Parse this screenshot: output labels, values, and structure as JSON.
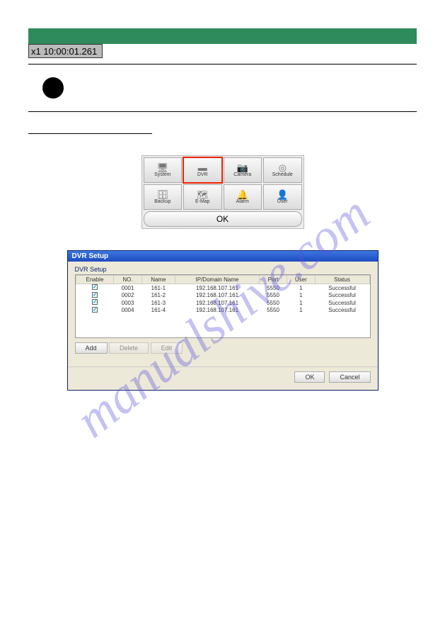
{
  "timestamp": "x1 10:00:01.261",
  "setup_grid": {
    "buttons": [
      {
        "label": "System",
        "icon": "🖥"
      },
      {
        "label": "DVR",
        "icon": "▬"
      },
      {
        "label": "Camera",
        "icon": "📷"
      },
      {
        "label": "Schedule",
        "icon": "◎"
      },
      {
        "label": "Backup",
        "icon": "🗄"
      },
      {
        "label": "E-Map",
        "icon": "🗺"
      },
      {
        "label": "Alarm",
        "icon": "🔔"
      },
      {
        "label": "User",
        "icon": "👤"
      }
    ],
    "ok_label": "OK"
  },
  "dvr_window": {
    "title": "DVR Setup",
    "group_label": "DVR Setup",
    "headers": [
      "Enable",
      "NO.",
      "Name",
      "IP/Domain Name",
      "Port",
      "User",
      "Status"
    ],
    "rows": [
      {
        "no": "0001",
        "name": "161-1",
        "ip": "192.168.107.161",
        "port": "5550",
        "user": "1",
        "status": "Successful"
      },
      {
        "no": "0002",
        "name": "161-2",
        "ip": "192.168.107.161",
        "port": "5550",
        "user": "1",
        "status": "Successful"
      },
      {
        "no": "0003",
        "name": "161-3",
        "ip": "192.168.107.161",
        "port": "5550",
        "user": "1",
        "status": "Successful"
      },
      {
        "no": "0004",
        "name": "161-4",
        "ip": "192.168.107.161",
        "port": "5550",
        "user": "1",
        "status": "Successful"
      }
    ],
    "btn_add": "Add",
    "btn_delete": "Delete",
    "btn_edit": "Edit",
    "btn_ok": "OK",
    "btn_cancel": "Cancel"
  },
  "watermark": "manualshive.com"
}
